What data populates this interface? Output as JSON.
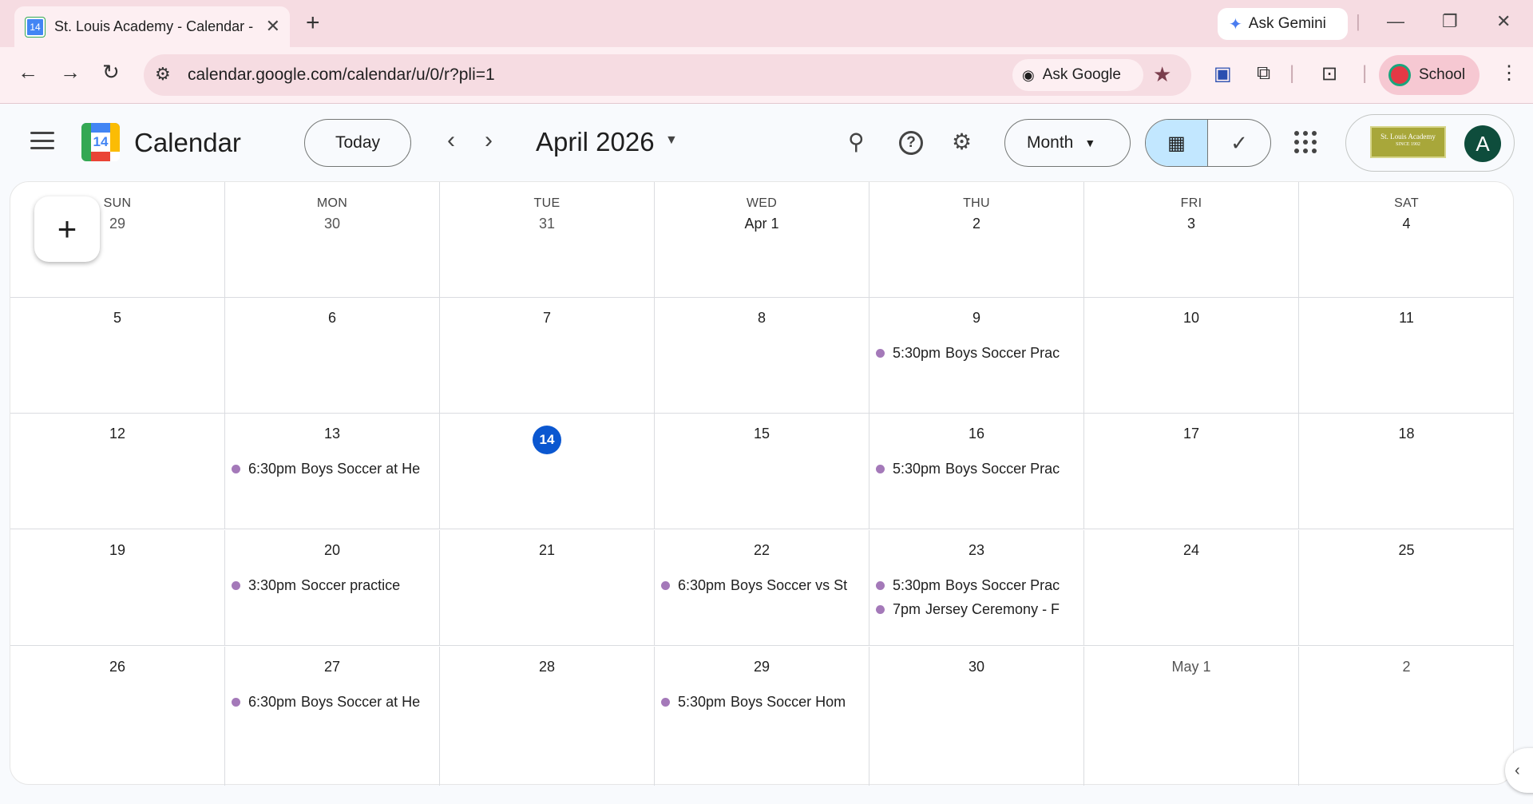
{
  "browser": {
    "tab_title": "St. Louis Academy - Calendar - A",
    "tab_favicon_text": "14",
    "new_tab_symbol": "+",
    "ask_gemini": "Ask Gemini",
    "url": "calendar.google.com/calendar/u/0/r?pli=1",
    "ask_google": "Ask Google",
    "profile_label": "School"
  },
  "header": {
    "app_name": "Calendar",
    "logo_day": "14",
    "today_button": "Today",
    "month_title": "April 2026",
    "view_selector": "Month",
    "account_logo_text": "St. Louis Academy",
    "account_logo_subtext": "SINCE 1902",
    "avatar_initial": "A"
  },
  "weekdays": [
    "SUN",
    "MON",
    "TUE",
    "WED",
    "THU",
    "FRI",
    "SAT"
  ],
  "weeks": [
    [
      {
        "date": "29",
        "muted": true,
        "events": []
      },
      {
        "date": "30",
        "muted": true,
        "events": []
      },
      {
        "date": "31",
        "muted": true,
        "events": []
      },
      {
        "date": "Apr 1",
        "events": []
      },
      {
        "date": "2",
        "events": []
      },
      {
        "date": "3",
        "events": []
      },
      {
        "date": "4",
        "events": []
      }
    ],
    [
      {
        "date": "5",
        "events": []
      },
      {
        "date": "6",
        "events": []
      },
      {
        "date": "7",
        "events": []
      },
      {
        "date": "8",
        "events": []
      },
      {
        "date": "9",
        "events": [
          {
            "time": "5:30pm",
            "title": "Boys Soccer Prac"
          }
        ]
      },
      {
        "date": "10",
        "events": []
      },
      {
        "date": "11",
        "events": []
      }
    ],
    [
      {
        "date": "12",
        "events": []
      },
      {
        "date": "13",
        "events": [
          {
            "time": "6:30pm",
            "title": "Boys Soccer at He"
          }
        ]
      },
      {
        "date": "14",
        "today": true,
        "events": []
      },
      {
        "date": "15",
        "events": []
      },
      {
        "date": "16",
        "events": [
          {
            "time": "5:30pm",
            "title": "Boys Soccer Prac"
          }
        ]
      },
      {
        "date": "17",
        "events": []
      },
      {
        "date": "18",
        "events": []
      }
    ],
    [
      {
        "date": "19",
        "events": []
      },
      {
        "date": "20",
        "events": [
          {
            "time": "3:30pm",
            "title": "Soccer practice"
          }
        ]
      },
      {
        "date": "21",
        "events": []
      },
      {
        "date": "22",
        "events": [
          {
            "time": "6:30pm",
            "title": "Boys Soccer vs St"
          }
        ]
      },
      {
        "date": "23",
        "events": [
          {
            "time": "5:30pm",
            "title": "Boys Soccer Prac"
          },
          {
            "time": "7pm",
            "title": "Jersey Ceremony - F"
          }
        ]
      },
      {
        "date": "24",
        "events": []
      },
      {
        "date": "25",
        "events": []
      }
    ],
    [
      {
        "date": "26",
        "events": []
      },
      {
        "date": "27",
        "events": [
          {
            "time": "6:30pm",
            "title": "Boys Soccer at He"
          }
        ]
      },
      {
        "date": "28",
        "events": []
      },
      {
        "date": "29",
        "events": [
          {
            "time": "5:30pm",
            "title": "Boys Soccer Hom"
          }
        ]
      },
      {
        "date": "30",
        "events": []
      },
      {
        "date": "May 1",
        "muted": true,
        "events": []
      },
      {
        "date": "2",
        "muted": true,
        "events": []
      }
    ]
  ],
  "colors": {
    "accent_today": "#0b57d0",
    "event_dot": "#a479b9",
    "view_active": "#c2e7ff",
    "chrome_tabbar": "#f6dce2"
  },
  "icons": {
    "create": "plus-icon",
    "search": "search-icon",
    "help": "help-icon",
    "settings": "gear-icon",
    "apps": "apps-grid-icon"
  }
}
